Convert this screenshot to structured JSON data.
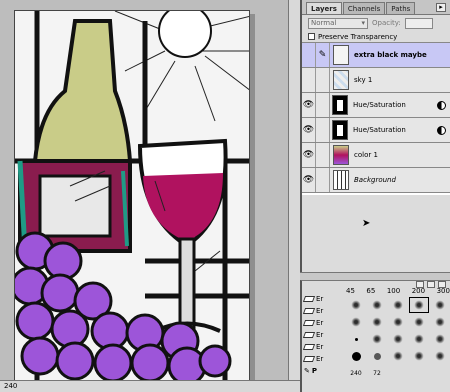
{
  "layers_palette": {
    "tabs": [
      "Layers",
      "Channels",
      "Paths"
    ],
    "blend_mode": "Normal",
    "opacity_label": "Opacity:",
    "preserve_transparency": "Preserve Transparency",
    "layers": [
      {
        "name": "extra black maybe",
        "visible": false,
        "selected": true,
        "style": "bold"
      },
      {
        "name": "sky 1",
        "visible": false,
        "selected": false,
        "style": "normal"
      },
      {
        "name": "Hue/Saturation",
        "visible": true,
        "selected": false,
        "style": "normal"
      },
      {
        "name": "Hue/Saturation",
        "visible": true,
        "selected": false,
        "style": "normal"
      },
      {
        "name": "color 1",
        "visible": true,
        "selected": false,
        "style": "normal"
      },
      {
        "name": "Background",
        "visible": true,
        "selected": false,
        "style": "italic"
      }
    ]
  },
  "brushes_palette": {
    "sizes": [
      "45",
      "65",
      "100",
      "200",
      "300"
    ],
    "history_labels": [
      "Er",
      "Er",
      "Er",
      "Er",
      "Er",
      "Er",
      "P"
    ],
    "bottom_numbers": [
      "240",
      "72"
    ]
  },
  "status": {
    "text": "240"
  },
  "colors": {
    "wine": "#b0125f",
    "bottle": "#c9cc88",
    "grapes": "#9d55d9",
    "teal": "#1f9b86",
    "selection": "#c8c8f5"
  }
}
